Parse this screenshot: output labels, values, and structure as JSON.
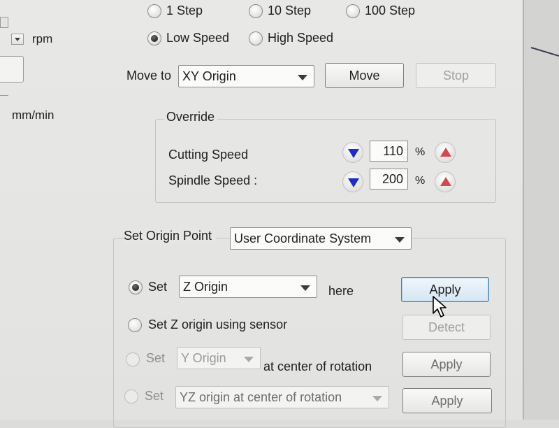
{
  "step": {
    "one": "1 Step",
    "ten": "10 Step",
    "hundred": "100 Step"
  },
  "speed": {
    "low": "Low Speed",
    "high": "High Speed"
  },
  "left": {
    "rpm_unit": "rpm",
    "feed_unit": "mm/min"
  },
  "move": {
    "label": "Move to",
    "combo_value": "XY Origin",
    "move_button": "Move",
    "stop_button": "Stop"
  },
  "override": {
    "title": "Override",
    "cutting_label": "Cutting Speed",
    "cutting_value": "110",
    "spindle_label": "Spindle Speed :",
    "spindle_value": "200",
    "unit": "%"
  },
  "origin": {
    "label": "Set Origin Point",
    "system_value": "User Coordinate System",
    "row1": {
      "set": "Set",
      "combo": "Z Origin",
      "suffix": "here",
      "button": "Apply"
    },
    "row2": {
      "text": "Set Z origin using sensor",
      "button": "Detect"
    },
    "row3": {
      "set": "Set",
      "combo": "Y Origin",
      "suffix": "at center of rotation",
      "button": "Apply"
    },
    "row4": {
      "set": "Set",
      "combo": "YZ origin at center of rotation",
      "button": "Apply"
    }
  }
}
